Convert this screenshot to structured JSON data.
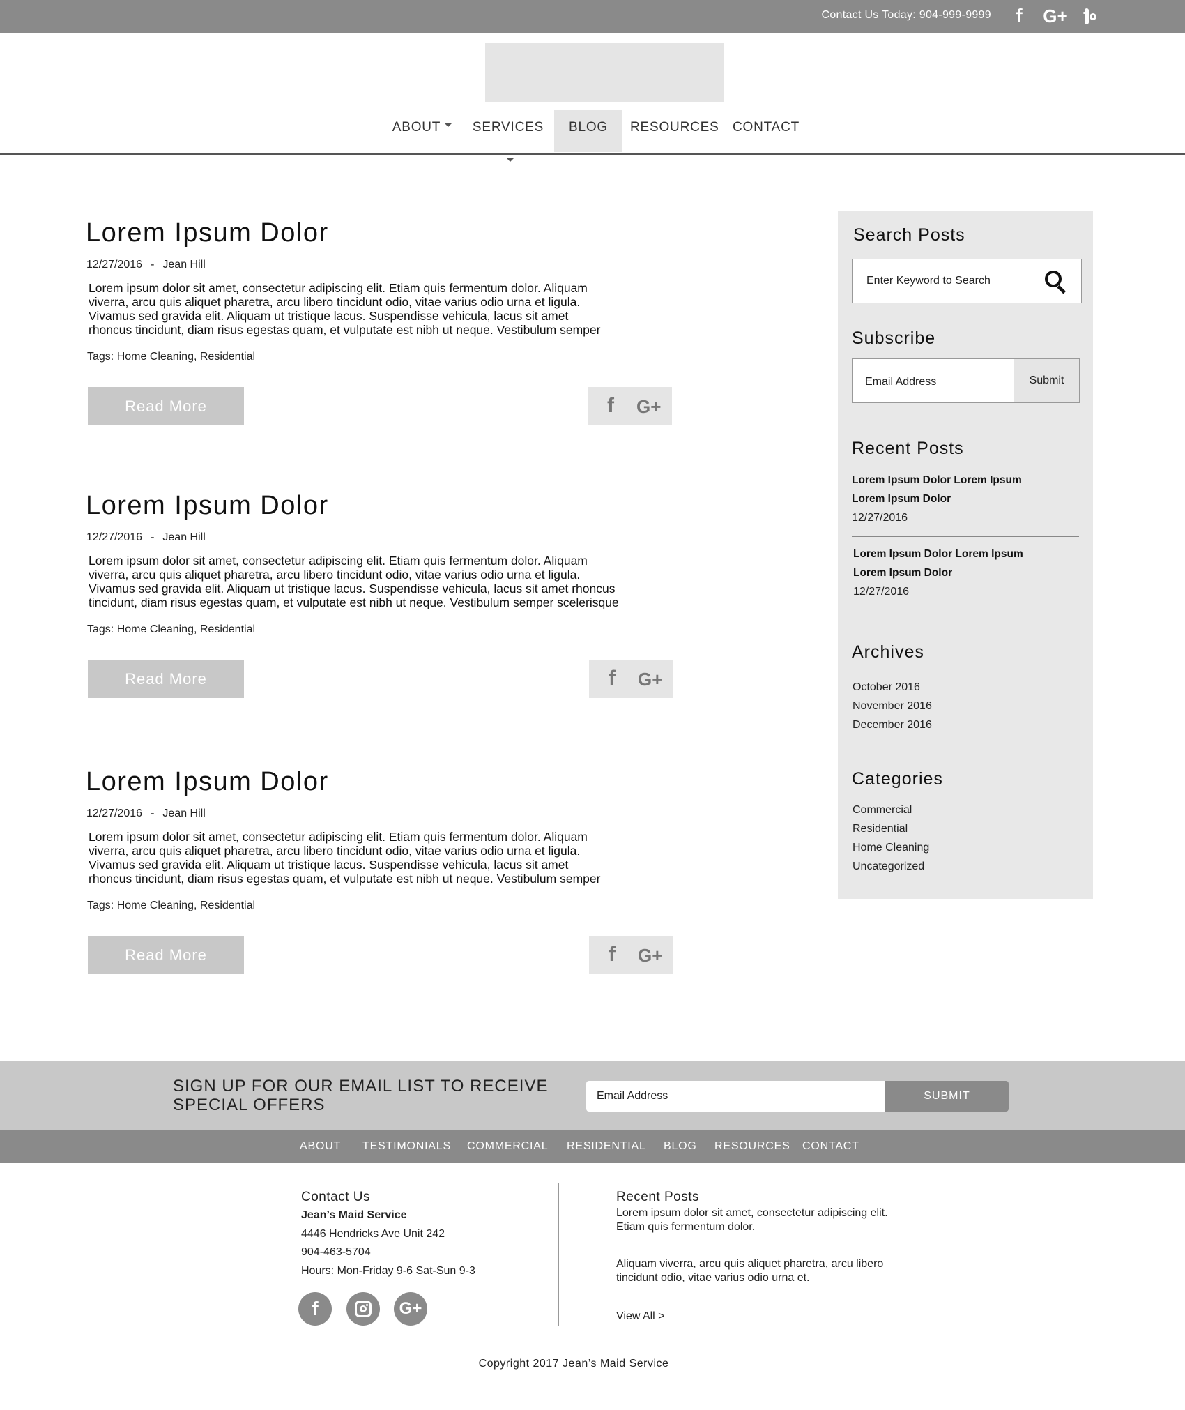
{
  "topbar": {
    "contact": "Contact Us Today: 904-999-9999",
    "icons": [
      "facebook-icon",
      "google-plus-icon",
      "instagram-icon"
    ],
    "fb_glyph": "f",
    "gp_glyph": "G+"
  },
  "nav": {
    "items": [
      {
        "label": "ABOUT",
        "dropdown": true
      },
      {
        "label": "SERVICES",
        "dropdown": true
      },
      {
        "label": "BLOG",
        "active": true
      },
      {
        "label": "RESOURCES"
      },
      {
        "label": "CONTACT"
      }
    ]
  },
  "posts": [
    {
      "title": "Lorem Ipsum Dolor",
      "date": "12/27/2016",
      "sep": "-",
      "author": "Jean Hill",
      "lines": [
        "Lorem ipsum dolor sit amet, consectetur adipiscing elit. Etiam quis fermentum dolor. Aliquam",
        "viverra, arcu quis aliquet pharetra, arcu libero tincidunt odio, vitae varius odio urna et ligula.",
        "Vivamus sed gravida elit. Aliquam ut tristique lacus. Suspendisse vehicula, lacus sit amet",
        "rhoncus tincidunt, diam risus egestas quam, et vulputate est nibh ut neque. Vestibulum semper"
      ],
      "tags": "Tags: Home Cleaning, Residential",
      "read_more": "Read More"
    },
    {
      "title": "Lorem Ipsum Dolor",
      "date": "12/27/2016",
      "sep": "-",
      "author": "Jean Hill",
      "lines": [
        "Lorem ipsum dolor sit amet, consectetur adipiscing elit. Etiam quis fermentum dolor. Aliquam",
        "viverra, arcu quis aliquet pharetra, arcu libero tincidunt odio, vitae varius odio urna et ligula.",
        "Vivamus sed gravida elit. Aliquam ut tristique lacus. Suspendisse vehicula, lacus sit amet rhoncus",
        "tincidunt, diam risus egestas quam, et vulputate est nibh ut neque. Vestibulum semper scelerisque"
      ],
      "tags": "Tags: Home Cleaning, Residential",
      "read_more": "Read More"
    },
    {
      "title": "Lorem Ipsum Dolor",
      "date": "12/27/2016",
      "sep": "-",
      "author": "Jean Hill",
      "lines": [
        "Lorem ipsum dolor sit amet, consectetur adipiscing elit. Etiam quis fermentum dolor. Aliquam",
        "viverra, arcu quis aliquet pharetra, arcu libero tincidunt odio, vitae varius odio urna et ligula.",
        "Vivamus sed gravida elit. Aliquam ut tristique lacus. Suspendisse vehicula, lacus sit amet",
        "rhoncus tincidunt, diam risus egestas quam, et vulputate est nibh ut neque. Vestibulum semper"
      ],
      "tags": "Tags: Home Cleaning, Residential",
      "read_more": "Read More"
    }
  ],
  "sidebar": {
    "search_title": "Search Posts",
    "search_placeholder": "Enter Keyword to Search",
    "subscribe_title": "Subscribe",
    "subscribe_placeholder": "Email Address",
    "subscribe_button": "Submit",
    "recent_title": "Recent Posts",
    "recent": [
      {
        "line1": "Lorem Ipsum Dolor Lorem Ipsum",
        "line2": "Lorem Ipsum Dolor",
        "date": "12/27/2016"
      },
      {
        "line1": "Lorem Ipsum Dolor Lorem Ipsum",
        "line2": "Lorem Ipsum Dolor",
        "date": "12/27/2016"
      }
    ],
    "archives_title": "Archives",
    "archives": [
      "October 2016",
      "November 2016",
      "December 2016"
    ],
    "categories_title": "Categories",
    "categories": [
      "Commercial",
      "Residential",
      "Home Cleaning",
      "Uncategorized"
    ]
  },
  "signup": {
    "line1": "SIGN UP FOR OUR EMAIL LIST TO  RECEIVE",
    "line2": "SPECIAL OFFERS",
    "placeholder": "Email Address",
    "button": "SUBMIT"
  },
  "footer_nav": [
    "ABOUT",
    "TESTIMONIALS",
    "COMMERCIAL",
    "RESIDENTIAL",
    "BLOG",
    "RESOURCES",
    "CONTACT"
  ],
  "footer": {
    "contact_title": "Contact Us",
    "business": "Jean’s Maid Service",
    "address": "4446 Hendricks Ave Unit 242",
    "phone": "904-463-5704",
    "hours": "Hours: Mon-Friday 9-6   Sat-Sun 9-3",
    "recent_title": "Recent Posts",
    "recent": [
      {
        "line1": "Lorem ipsum dolor sit amet, consectetur adipiscing elit.",
        "line2": "Etiam quis fermentum dolor."
      },
      {
        "line1": "Aliquam viverra, arcu quis aliquet pharetra, arcu libero",
        "line2": "tincidunt odio, vitae varius odio urna et."
      }
    ],
    "view_all": "View All >",
    "copyright": "Copyright 2017 Jean’s Maid Service"
  },
  "colors": {
    "bar": "#8a8a8a",
    "light": "#e5e5e5",
    "sidebar": "#e8e8e8",
    "button": "#c8c8c8"
  }
}
